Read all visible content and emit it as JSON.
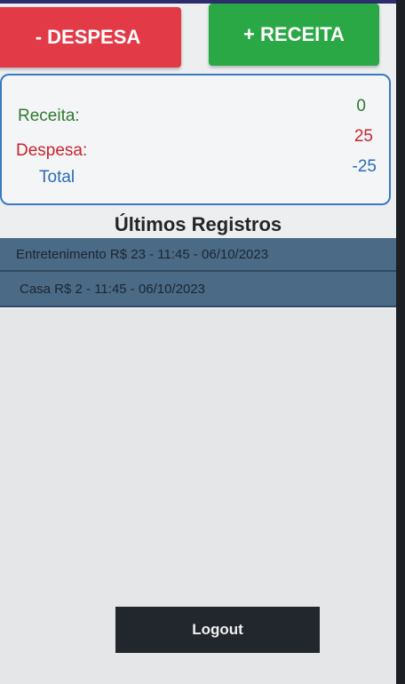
{
  "buttons": {
    "despesa": "- DESPESA",
    "receita": "+ RECEITA",
    "logout": "Logout"
  },
  "summary": {
    "receita_label": "Receita:",
    "despesa_label": "Despesa:",
    "total_label": "Total",
    "receita_value": "0",
    "despesa_value": "25",
    "total_value": "-25"
  },
  "records_title": "Últimos Registros",
  "records": [
    "Entretenimento R$ 23 - 11:45 - 06/10/2023",
    "Casa R$ 2 - 11:45 - 06/10/2023"
  ],
  "colors": {
    "despesa": "#e23a46",
    "receita": "#2aa845",
    "total": "#2b6cb4",
    "record_row": "#4a6a86"
  }
}
